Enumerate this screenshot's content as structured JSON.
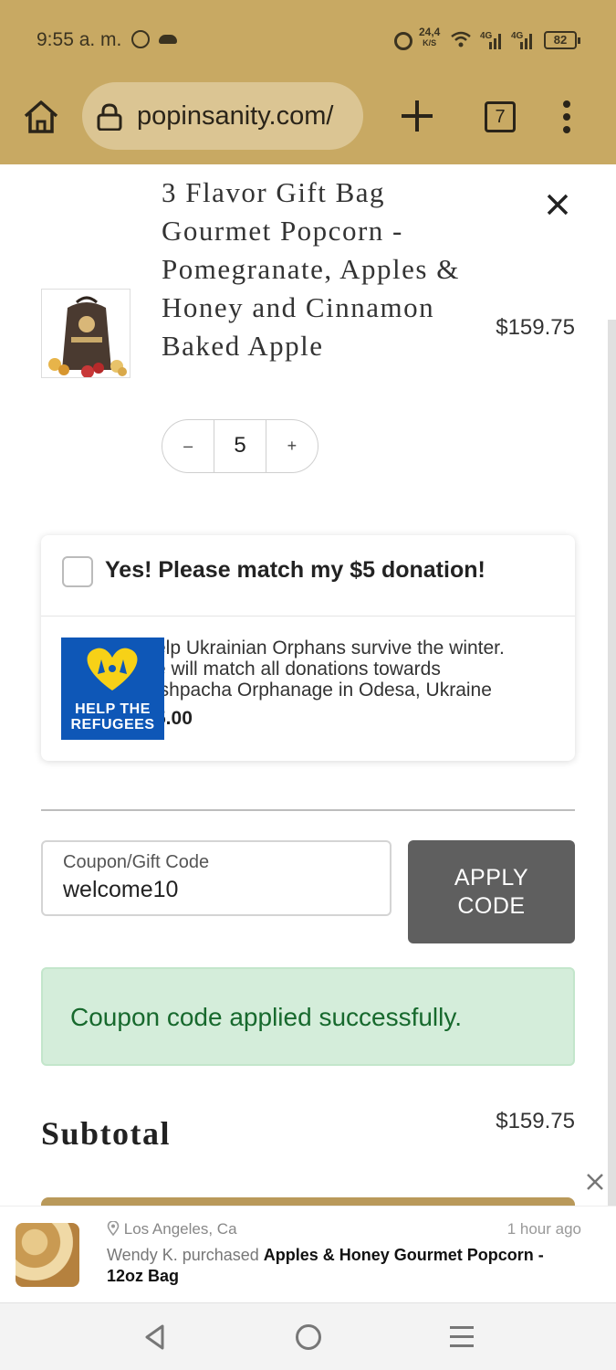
{
  "status_bar": {
    "time": "9:55 a. m.",
    "network_speed_value": "24,4",
    "network_speed_unit": "K/S",
    "signal_1": "4G",
    "signal_2": "4G",
    "battery": "82",
    "icons": [
      "whatsapp-icon",
      "cloud-icon",
      "alarm-icon",
      "wifi-icon",
      "signal-icon",
      "battery-icon"
    ]
  },
  "browser": {
    "url": "popinsanity.com/",
    "tab_count": "7",
    "icons": [
      "home-icon",
      "lock-icon",
      "new-tab-icon",
      "tabs-icon",
      "more-icon"
    ]
  },
  "cart": {
    "item": {
      "title": "3 Flavor Gift Bag Gourmet Popcorn - Pomegranate, Apples & Honey and Cinnamon Baked Apple",
      "price": "$159.75",
      "quantity": "5",
      "decrement": "–",
      "increment": "+"
    },
    "donation": {
      "checkbox_label": "Yes! Please match my $5 donation!",
      "checked": false,
      "description_lines": [
        "elp Ukrainian Orphans survive the winter.",
        "e will match all donations towards",
        "ishpacha Orphanage in Odesa, Ukraine"
      ],
      "amount": "5.00",
      "badge_line1": "HELP THE",
      "badge_line2": "REFUGEES"
    },
    "coupon": {
      "placeholder": "Coupon/Gift Code",
      "value": "welcome10",
      "apply_label_line1": "APPLY",
      "apply_label_line2": "CODE"
    },
    "success_message": "Coupon code applied successfully.",
    "subtotal_label": "Subtotal",
    "subtotal_value": "$159.75"
  },
  "toast": {
    "location": "Los Angeles, Ca",
    "time_ago": "1 hour ago",
    "buyer_text": "Wendy K. purchased ",
    "product": "Apples & Honey Gourmet Popcorn - 12oz Bag"
  },
  "colors": {
    "chrome": "#c8a963",
    "urlbar": "#dbc593",
    "apply_button": "#5f5f5f",
    "success_bg": "#d4edda",
    "success_text": "#17692d",
    "badge_blue": "#0e57b7",
    "badge_yellow": "#f7d117"
  }
}
